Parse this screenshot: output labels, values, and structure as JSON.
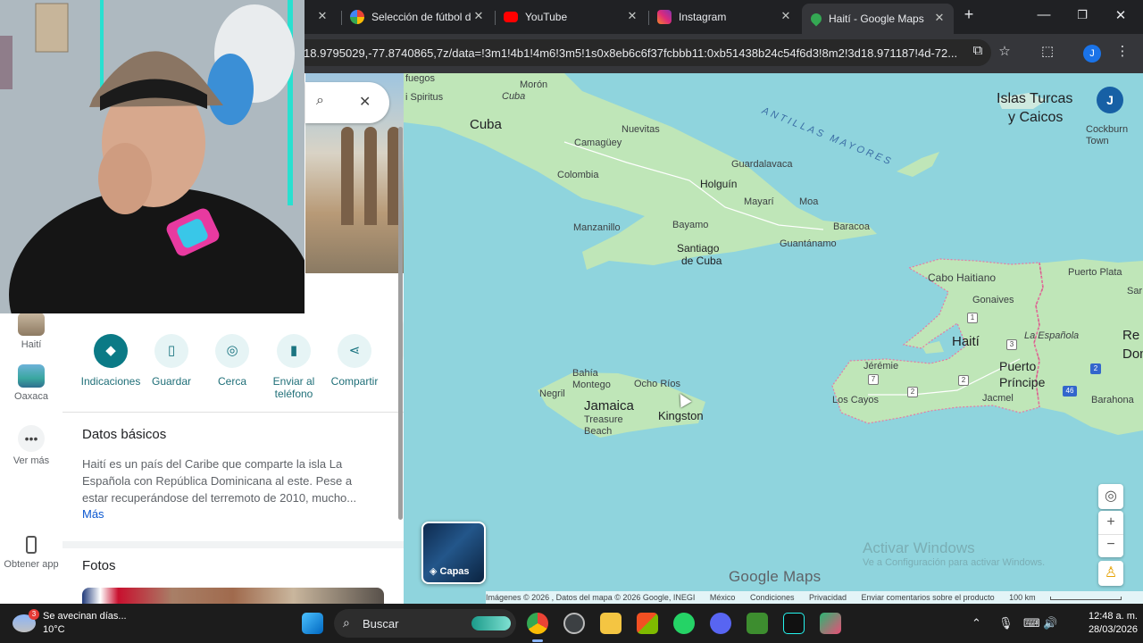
{
  "browser": {
    "tabs": [
      {
        "label": "Selección de fútbol d",
        "active": false
      },
      {
        "label": "YouTube",
        "active": false
      },
      {
        "label": "Instagram",
        "active": false
      },
      {
        "label": "Haití - Google Maps",
        "active": true
      }
    ],
    "new_tab": "+",
    "url": "18.9795029,-77.8740865,7z/data=!3m1!4b1!4m6!3m5!1s0x8eb6c6f37fcbbb11:0xb51438b24c54f6d3!8m2!3d18.971187!4d-72...",
    "profile_initial": "J"
  },
  "rail": {
    "items": [
      {
        "label": "Haití"
      },
      {
        "label": "Oaxaca"
      },
      {
        "label": "Ver más"
      },
      {
        "label": "Obtener app"
      }
    ]
  },
  "panel": {
    "actions": [
      {
        "label": "Indicaciones",
        "icon": "directions-icon"
      },
      {
        "label": "Guardar",
        "icon": "bookmark-icon"
      },
      {
        "label": "Cerca",
        "icon": "nearby-icon"
      },
      {
        "label": "Enviar al teléfono",
        "icon": "send-to-phone-icon"
      },
      {
        "label": "Compartir",
        "icon": "share-icon"
      }
    ],
    "basic_title": "Datos básicos",
    "description": "Haití es un país del Caribe que comparte la isla La Española con República Dominicana al este. Pese a estar recuperándose del terremoto de 2010, mucho...",
    "more": "Más",
    "photos_title": "Fotos"
  },
  "map": {
    "labels": {
      "fuegos": "fuegos",
      "moron": "Morón",
      "cuba_it": "Cuba",
      "spiritus": "i Spiritus",
      "cuba": "Cuba",
      "nuevitas": "Nuevitas",
      "camaguey": "Camagüey",
      "antillas": "ANTILLAS MAYORES",
      "guardalavaca": "Guardalavaca",
      "colombia": "Colombia",
      "holguin": "Holguín",
      "mayari": "Mayarí",
      "moa": "Moa",
      "manzanillo": "Manzanillo",
      "bayamo": "Bayamo",
      "baracoa": "Baracoa",
      "guantanamo": "Guantánamo",
      "santiago": "Santiago",
      "de_cuba": "de Cuba",
      "islas_turcas": "Islas Turcas",
      "y_caicos": "y Caicos",
      "cockburn": "Cockburn",
      "town": "Town",
      "cabo_haitiano": "Cabo Haitiano",
      "puerto_plata": "Puerto Plata",
      "gonaives": "Gonaives",
      "haiti": "Haití",
      "la_espanola": "La Española",
      "re": "Re",
      "dom": "Dom",
      "jeremie": "Jérémie",
      "puerto": "Puerto",
      "principe": "Príncipe",
      "los_cayos": "Los Cayos",
      "jacmel": "Jacmel",
      "barahona": "Barahona",
      "bahia": "Bahía",
      "montego": "Montego",
      "ocho_rios": "Ocho Ríos",
      "negril": "Negril",
      "jamaica": "Jamaica",
      "kingston": "Kingston",
      "treasure": "Treasure",
      "beach": "Beach",
      "sar": "Sar"
    },
    "shields": [
      "1",
      "3",
      "7",
      "2",
      "2",
      "2",
      "46"
    ],
    "layers_label": "Capas",
    "logo": "Google Maps",
    "avatar_initial": "J",
    "watermark_title": "Activar Windows",
    "watermark_sub": "Ve a Configuración para activar Windows.",
    "footer": [
      "Imágenes © 2026 , Datos del mapa © 2026 Google, INEGI",
      "México",
      "Condiciones",
      "Privacidad",
      "Enviar comentarios sobre el producto",
      "100 km"
    ]
  },
  "taskbar": {
    "weather_text": "Se avecinan días...",
    "weather_temp": "10°C",
    "weather_badge": "3",
    "search": "Buscar",
    "time": "12:48 a. m.",
    "date": "28/03/2026"
  },
  "colors": {
    "water": "#8fd4dd",
    "land": "#bfe6b8",
    "accent": "#0b7a86",
    "link": "#0b57d0",
    "border": "#d65a8a"
  }
}
